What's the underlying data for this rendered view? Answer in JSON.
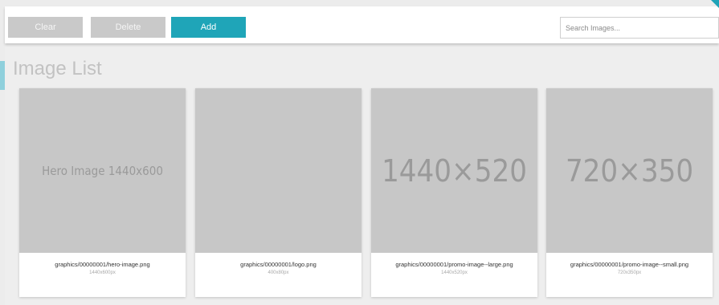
{
  "toolbar": {
    "clear_label": "Clear",
    "delete_label": "Delete",
    "add_label": "Add",
    "search_placeholder": "Search Images..."
  },
  "page": {
    "title": "Image List"
  },
  "images": [
    {
      "thumb_text": "Hero Image 1440x600",
      "filename": "graphics/00000001/hero-image.png",
      "size": "1440x600px"
    },
    {
      "thumb_text": "",
      "filename": "graphics/00000001/logo.png",
      "size": "400x80px"
    },
    {
      "thumb_text": "1440×520",
      "filename": "graphics/00000001/promo-image--large.png",
      "size": "1440x520px"
    },
    {
      "thumb_text": "720×350",
      "filename": "graphics/00000001/promo-image--small.png",
      "size": "720x350px"
    }
  ],
  "colors": {
    "accent": "#1fa5b8",
    "disabled_button": "#c9c9c9",
    "thumbnail_bg": "#c7c7c7",
    "panel_bg": "#eeeeee"
  }
}
